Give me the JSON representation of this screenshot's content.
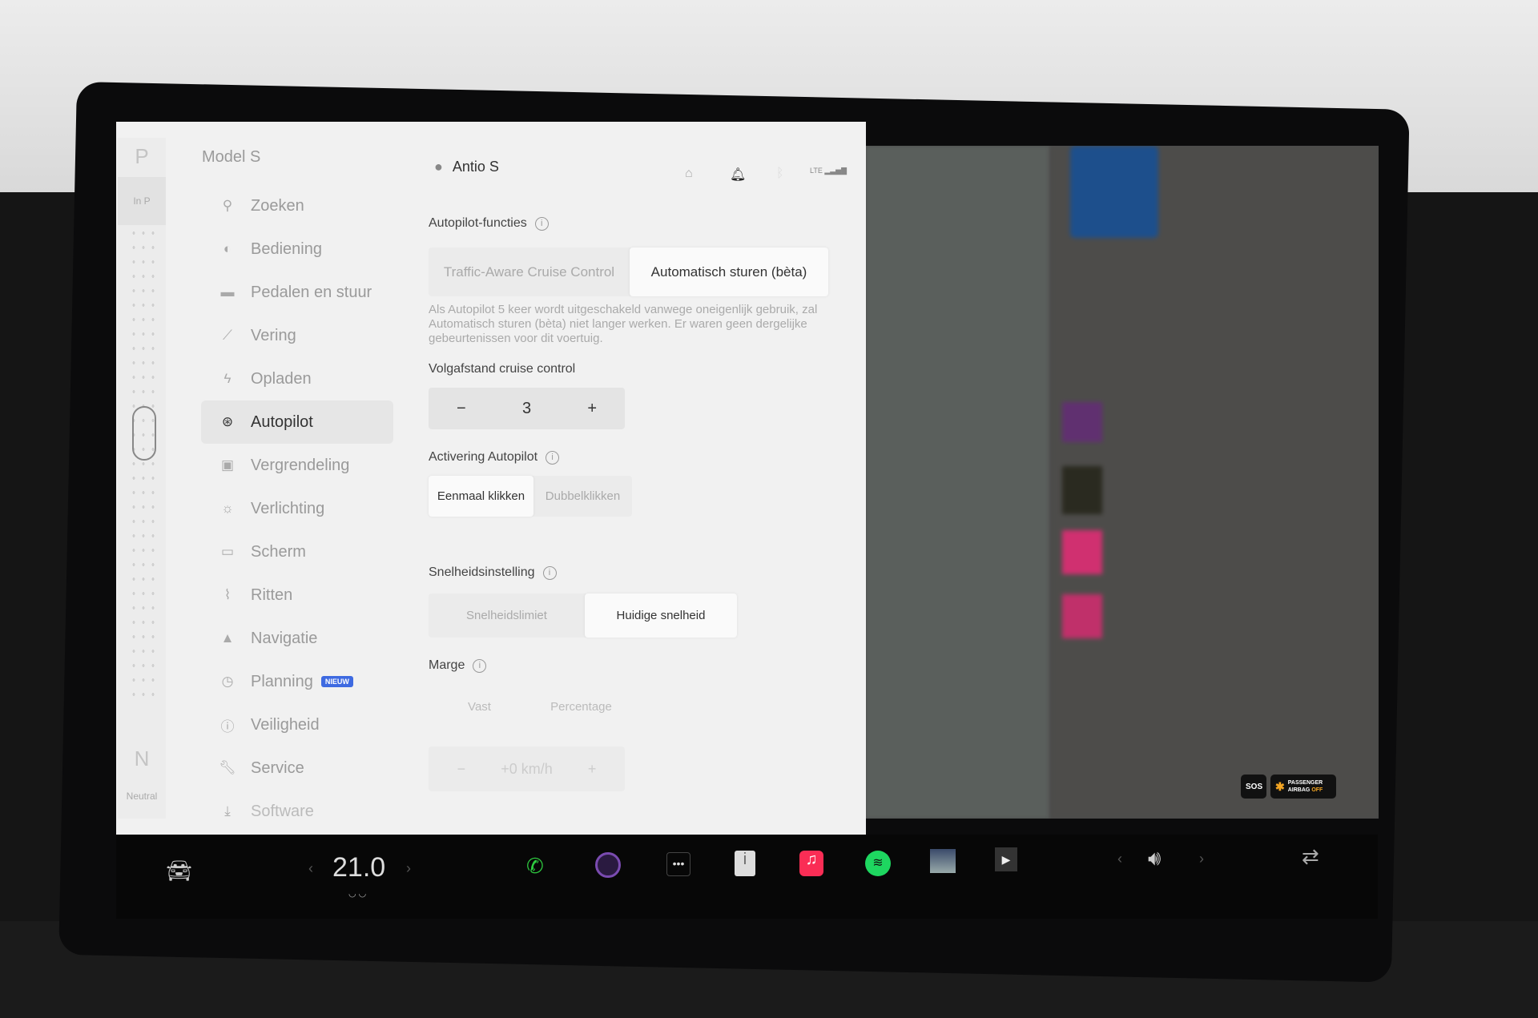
{
  "gear": {
    "current": "P",
    "status": "In P",
    "bottom": "N",
    "bottom_label": "Neutral"
  },
  "sidebar": {
    "title": "Model S",
    "items": [
      {
        "label": "Zoeken",
        "icon": "search-icon"
      },
      {
        "label": "Bediening",
        "icon": "toggle-icon"
      },
      {
        "label": "Pedalen en stuur",
        "icon": "car-icon"
      },
      {
        "label": "Vering",
        "icon": "wrench-icon"
      },
      {
        "label": "Opladen",
        "icon": "bolt-icon"
      },
      {
        "label": "Autopilot",
        "icon": "steering-wheel-icon",
        "selected": true
      },
      {
        "label": "Vergrendeling",
        "icon": "lock-icon"
      },
      {
        "label": "Verlichting",
        "icon": "light-icon"
      },
      {
        "label": "Scherm",
        "icon": "screen-icon"
      },
      {
        "label": "Ritten",
        "icon": "trips-icon"
      },
      {
        "label": "Navigatie",
        "icon": "navigation-icon"
      },
      {
        "label": "Planning",
        "icon": "clock-icon",
        "badge": "NIEUW"
      },
      {
        "label": "Veiligheid",
        "icon": "alert-icon"
      },
      {
        "label": "Service",
        "icon": "wrench-icon"
      },
      {
        "label": "Software",
        "icon": "download-icon"
      }
    ]
  },
  "header": {
    "user": "Antio S",
    "signal": "LTE"
  },
  "autopilot": {
    "functions_label": "Autopilot-functies",
    "functions_options": [
      "Traffic-Aware Cruise Control",
      "Automatisch sturen (bèta)"
    ],
    "functions_selected": 1,
    "description": "Als Autopilot 5 keer wordt uitgeschakeld vanwege oneigenlijk gebruik, zal Automatisch sturen (bèta) niet langer werken. Er waren geen dergelijke gebeurtenissen voor dit voertuig.",
    "distance_label": "Volgafstand cruise control",
    "distance_value": "3",
    "activation_label": "Activering Autopilot",
    "activation_options": [
      "Eenmaal klikken",
      "Dubbelklikken"
    ],
    "activation_selected": 0,
    "speed_label": "Snelheidsinstelling",
    "speed_options": [
      "Snelheidslimiet",
      "Huidige snelheid"
    ],
    "speed_selected": 1,
    "margin_label": "Marge",
    "margin_options": [
      "Vast",
      "Percentage"
    ],
    "margin_value": "+0 km/h"
  },
  "taskbar": {
    "temperature": "21.0",
    "sos": "SOS",
    "airbag_line1": "PASSENGER",
    "airbag_line2": "AIRBAG",
    "airbag_state": "OFF"
  },
  "colors": {
    "accent": "#3e6ae1",
    "phone": "#2ecc40",
    "spotify": "#1ed760",
    "music": "#fa2d55",
    "airbag": "#f5a623"
  }
}
